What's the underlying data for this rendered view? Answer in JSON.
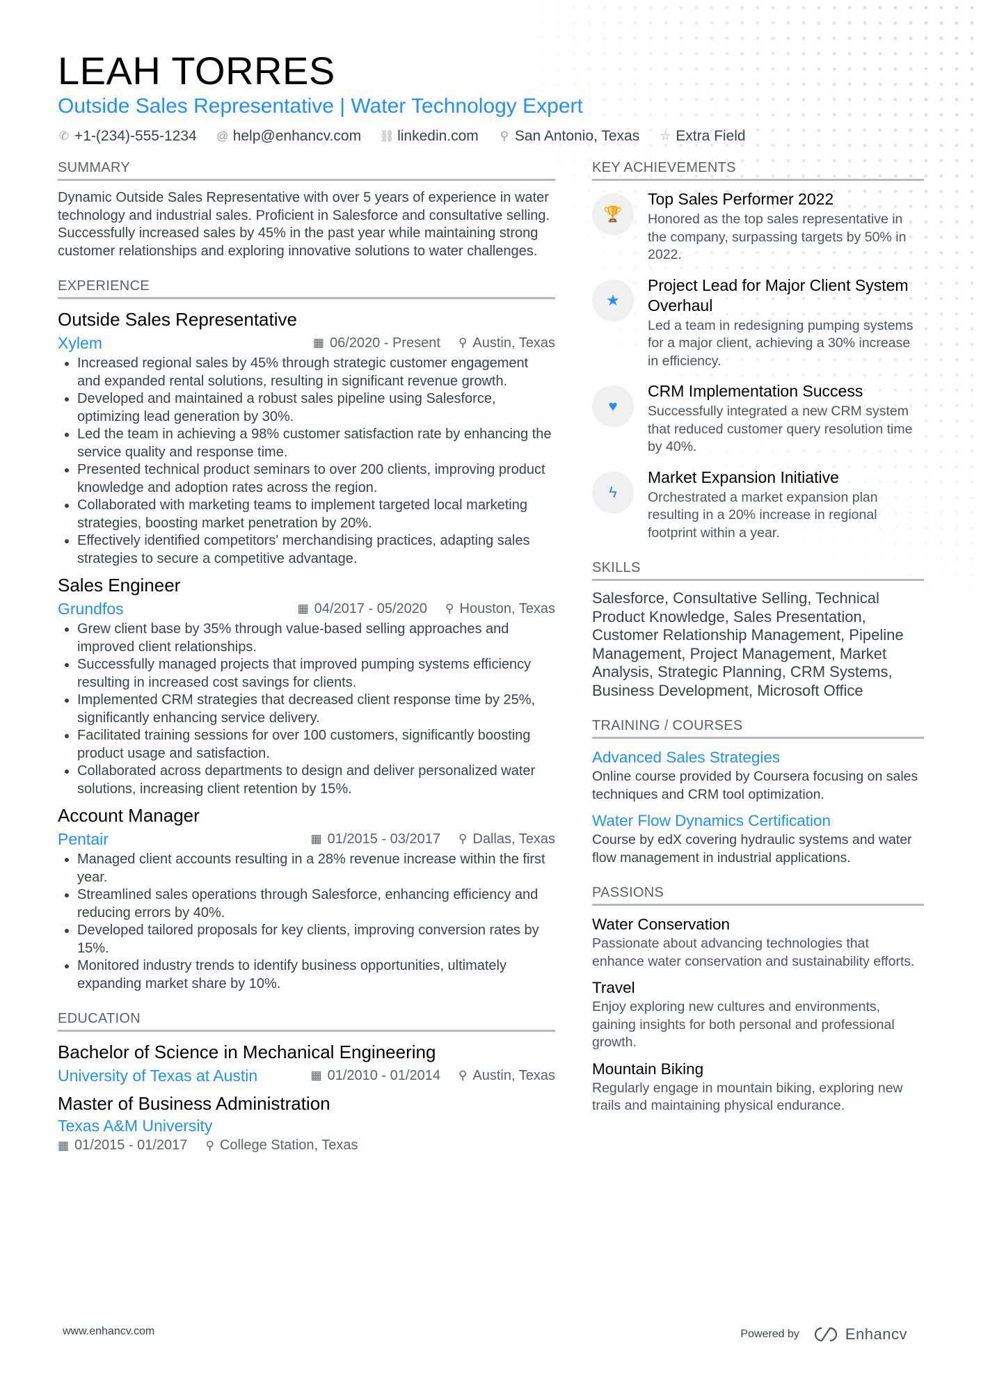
{
  "header": {
    "name": "LEAH TORRES",
    "title": "Outside Sales Representative | Water Technology Expert",
    "contacts": [
      {
        "icon": "phone-icon",
        "glyph": "✆",
        "text": "+1-(234)-555-1234"
      },
      {
        "icon": "at-icon",
        "glyph": "@",
        "text": "help@enhancv.com"
      },
      {
        "icon": "link-icon",
        "glyph": "⛓",
        "text": "linkedin.com"
      },
      {
        "icon": "location-pin-icon",
        "glyph": "⚲",
        "text": "San Antonio, Texas"
      },
      {
        "icon": "star-outline-icon",
        "glyph": "☆",
        "text": "Extra Field"
      }
    ]
  },
  "summary": {
    "heading": "Summary",
    "text": "Dynamic Outside Sales Representative with over 5 years of experience in water technology and industrial sales. Proficient in Salesforce and consultative selling. Successfully increased sales by 45% in the past year while maintaining strong customer relationships and exploring innovative solutions to water challenges."
  },
  "experience": {
    "heading": "Experience",
    "jobs": [
      {
        "title": "Outside Sales Representative",
        "company": "Xylem",
        "dates": "06/2020 - Present",
        "location": "Austin, Texas",
        "bullets": [
          "Increased regional sales by 45% through strategic customer engagement and expanded rental solutions, resulting in significant revenue growth.",
          "Developed and maintained a robust sales pipeline using Salesforce, optimizing lead generation by 30%.",
          "Led the team in achieving a 98% customer satisfaction rate by enhancing the service quality and response time.",
          "Presented technical product seminars to over 200 clients, improving product knowledge and adoption rates across the region.",
          "Collaborated with marketing teams to implement targeted local marketing strategies, boosting market penetration by 20%.",
          "Effectively identified competitors' merchandising practices, adapting sales strategies to secure a competitive advantage."
        ]
      },
      {
        "title": "Sales Engineer",
        "company": "Grundfos",
        "dates": "04/2017 - 05/2020",
        "location": "Houston, Texas",
        "bullets": [
          "Grew client base by 35% through value-based selling approaches and improved client relationships.",
          "Successfully managed projects that improved pumping systems efficiency resulting in increased cost savings for clients.",
          "Implemented CRM strategies that decreased client response time by 25%, significantly enhancing service delivery.",
          "Facilitated training sessions for over 100 customers, significantly boosting product usage and satisfaction.",
          "Collaborated across departments to design and deliver personalized water solutions, increasing client retention by 15%."
        ]
      },
      {
        "title": "Account Manager",
        "company": "Pentair",
        "dates": "01/2015 - 03/2017",
        "location": "Dallas, Texas",
        "bullets": [
          "Managed client accounts resulting in a 28% revenue increase within the first year.",
          "Streamlined sales operations through Salesforce, enhancing efficiency and reducing errors by 40%.",
          "Developed tailored proposals for key clients, improving conversion rates by 15%.",
          "Monitored industry trends to identify business opportunities, ultimately expanding market share by 10%."
        ]
      }
    ]
  },
  "education": {
    "heading": "Education",
    "items": [
      {
        "degree": "Bachelor of Science in Mechanical Engineering",
        "school": "University of Texas at Austin",
        "dates": "01/2010 - 01/2014",
        "location": "Austin, Texas"
      },
      {
        "degree": "Master of Business Administration",
        "school": "Texas A&M University",
        "dates": "01/2015 - 01/2017",
        "location": "College Station, Texas"
      }
    ]
  },
  "achievements": {
    "heading": "Key Achievements",
    "items": [
      {
        "icon": "trophy-icon",
        "glyph": "🏆",
        "title": "Top Sales Performer 2022",
        "desc": "Honored as the top sales representative in the company, surpassing targets by 50% in 2022."
      },
      {
        "icon": "star-icon",
        "glyph": "★",
        "title": "Project Lead for Major Client System Overhaul",
        "desc": "Led a team in redesigning pumping systems for a major client, achieving a 30% increase in efficiency."
      },
      {
        "icon": "heart-icon",
        "glyph": "♥",
        "title": "CRM Implementation Success",
        "desc": "Successfully integrated a new CRM system that reduced customer query resolution time by 40%."
      },
      {
        "icon": "lightning-bolt-icon",
        "glyph": "ϟ",
        "title": "Market Expansion Initiative",
        "desc": "Orchestrated a market expansion plan resulting in a 20% increase in regional footprint within a year."
      }
    ]
  },
  "skills": {
    "heading": "Skills",
    "text": "Salesforce, Consultative Selling, Technical Product Knowledge, Sales Presentation, Customer Relationship Management, Pipeline Management, Project Management, Market Analysis, Strategic Planning, CRM Systems, Business Development, Microsoft Office"
  },
  "training": {
    "heading": "Training / Courses",
    "items": [
      {
        "title": "Advanced Sales Strategies",
        "desc": "Online course provided by Coursera focusing on sales techniques and CRM tool optimization."
      },
      {
        "title": "Water Flow Dynamics Certification",
        "desc": "Course by edX covering hydraulic systems and water flow management in industrial applications."
      }
    ]
  },
  "passions": {
    "heading": "Passions",
    "items": [
      {
        "title": "Water Conservation",
        "desc": "Passionate about advancing technologies that enhance water conservation and sustainability efforts."
      },
      {
        "title": "Travel",
        "desc": "Enjoy exploring new cultures and environments, gaining insights for both personal and professional growth."
      },
      {
        "title": "Mountain Biking",
        "desc": "Regularly engage in mountain biking, exploring new trails and maintaining physical endurance."
      }
    ]
  },
  "footer": {
    "website": "www.enhancv.com",
    "powered_by": "Powered by",
    "brand": "Enhancv"
  },
  "icons": {
    "calendar": "▦",
    "pin": "⚲"
  },
  "colors": {
    "accent": "#1e90ff",
    "text": "#384347",
    "heading_rule": "#b7babd"
  }
}
